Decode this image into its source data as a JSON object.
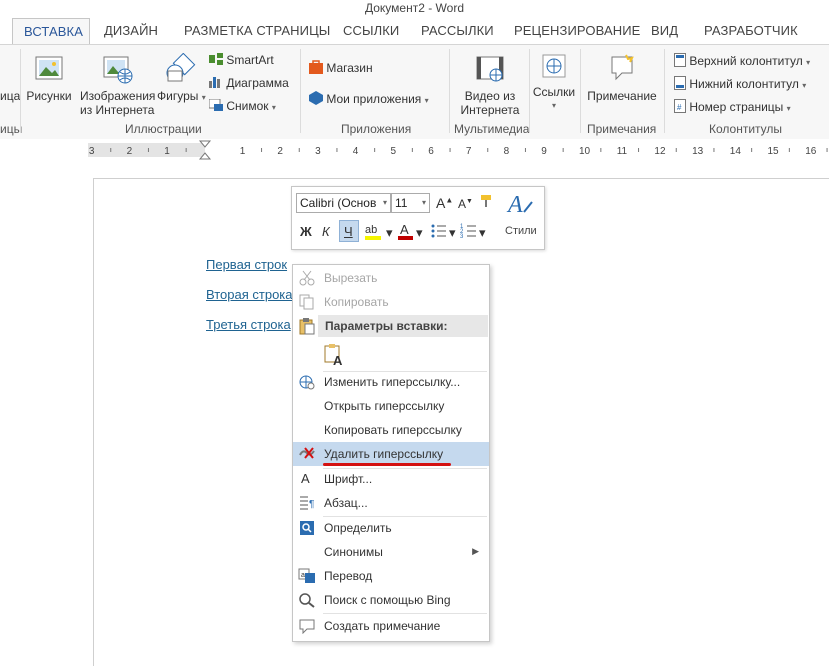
{
  "window": {
    "title": "Документ2 - Word"
  },
  "tabs": [
    {
      "label": "ВСТАВКА",
      "active": true
    },
    {
      "label": "ДИЗАЙН"
    },
    {
      "label": "РАЗМЕТКА СТРАНИЦЫ"
    },
    {
      "label": "ССЫЛКИ"
    },
    {
      "label": "РАССЫЛКИ"
    },
    {
      "label": "РЕЦЕНЗИРОВАНИЕ"
    },
    {
      "label": "ВИД"
    },
    {
      "label": "РАЗРАБОТЧИК"
    }
  ],
  "ribbon": {
    "left_cut": {
      "btn_text": "ица",
      "group": "ицы"
    },
    "illustrations": {
      "pictures": "Рисунки",
      "online_pictures_1": "Изображения",
      "online_pictures_2": "из Интернета",
      "shapes": "Фигуры",
      "smartart": "SmartArt",
      "chart": "Диаграмма",
      "screenshot": "Снимок",
      "group": "Иллюстрации"
    },
    "apps": {
      "store": "Магазин",
      "my_apps": "Мои приложения",
      "group": "Приложения"
    },
    "media": {
      "video_1": "Видео из",
      "video_2": "Интернета",
      "group": "Мультимедиа"
    },
    "links": {
      "label": "Ссылки"
    },
    "comments": {
      "comment": "Примечание",
      "group": "Примечания"
    },
    "header_footer": {
      "header": "Верхний колонтитул",
      "footer": "Нижний колонтитул",
      "page_number": "Номер страницы",
      "group": "Колонтитулы"
    }
  },
  "ruler": {
    "numbers": [
      "3",
      "2",
      "1",
      "1",
      "2",
      "3",
      "4",
      "5",
      "6",
      "7",
      "8",
      "9",
      "10",
      "11",
      "12",
      "13",
      "14",
      "15",
      "16"
    ]
  },
  "document": {
    "lines": [
      "Первая строк",
      "Вторая строка",
      "Третья строка"
    ]
  },
  "mini_toolbar": {
    "font": "Calibri (Основ",
    "size": "11",
    "bold": "Ж",
    "italic": "К",
    "underline": "Ч",
    "styles": "Стили",
    "accent": "#c00000"
  },
  "context_menu": {
    "cut": "Вырезать",
    "copy": "Копировать",
    "paste_header": "Параметры вставки:",
    "edit_link": "Изменить гиперссылку...",
    "open_link": "Открыть гиперссылку",
    "copy_link": "Копировать гиперссылку",
    "remove_link": "Удалить гиперссылку",
    "font": "Шрифт...",
    "paragraph": "Абзац...",
    "define": "Определить",
    "synonyms": "Синонимы",
    "translate": "Перевод",
    "search_bing": "Поиск с помощью Bing",
    "new_comment": "Создать примечание"
  }
}
